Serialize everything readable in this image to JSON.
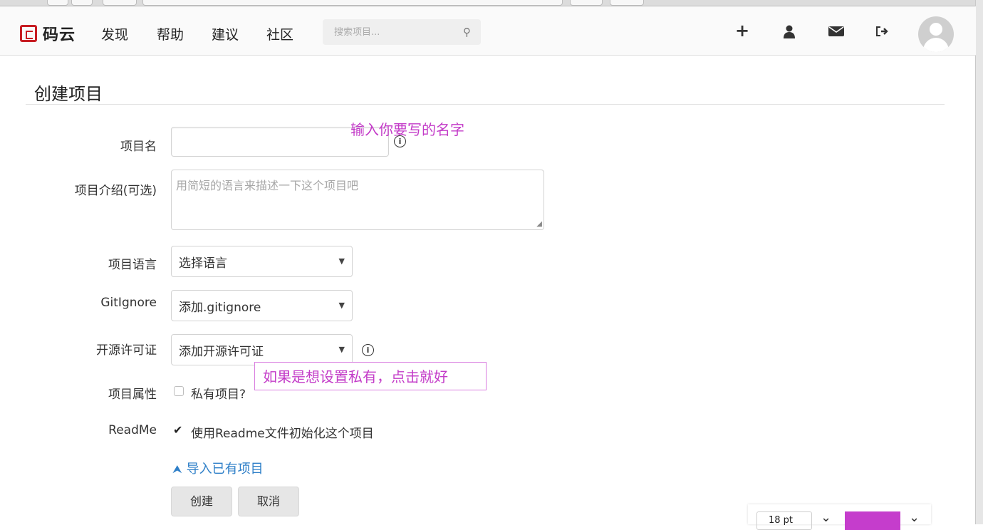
{
  "navbar": {
    "brand": "码云",
    "links": [
      "发现",
      "帮助",
      "建议",
      "社区"
    ],
    "search_placeholder": "搜索项目..."
  },
  "page_title": "创建项目",
  "form": {
    "name_label": "项目名",
    "desc_label": "项目介绍(可选)",
    "desc_placeholder": "用简短的语言来描述一下这个项目吧",
    "language_label": "项目语言",
    "language_value": "选择语言",
    "gitignore_label": "GitIgnore",
    "gitignore_value": "添加.gitignore",
    "license_label": "开源许可证",
    "license_value": "添加开源许可证",
    "property_label": "项目属性",
    "private_text": "私有项目?",
    "private_checked": false,
    "readme_label": "ReadMe",
    "readme_text": "使用Readme文件初始化这个项目",
    "readme_checked": true,
    "import_link": "导入已有项目",
    "create_button": "创建",
    "cancel_button": "取消"
  },
  "annotations": {
    "name_hint": "输入你要写的名字",
    "private_hint": "如果是想设置私有，点击就好"
  },
  "overlay_toolbar": {
    "font_size": "18 pt",
    "color": "#c53dcc"
  },
  "colors": {
    "brand_red": "#c71d23",
    "link_blue": "#2e7fc8",
    "annotation_magenta": "#c33bc8"
  }
}
